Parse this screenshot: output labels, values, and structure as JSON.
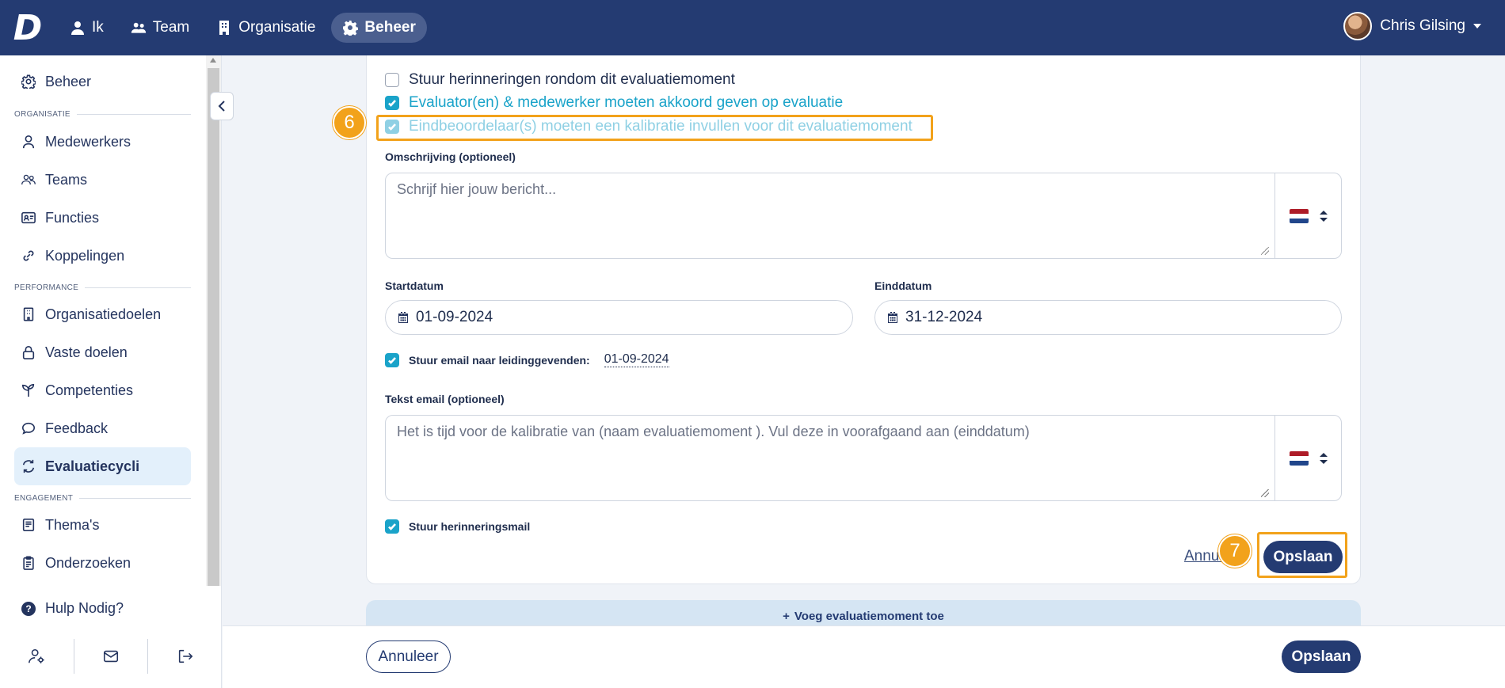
{
  "topbar": {
    "logo": "D",
    "nav": [
      {
        "label": "Ik",
        "icon": "person-icon"
      },
      {
        "label": "Team",
        "icon": "users-icon"
      },
      {
        "label": "Organisatie",
        "icon": "building-icon"
      },
      {
        "label": "Beheer",
        "icon": "gear-icon",
        "active": true
      }
    ],
    "user_name": "Chris Gilsing"
  },
  "sidebar": {
    "top_item": "Beheer",
    "sections": {
      "organisatie": "ORGANISATIE",
      "performance": "PERFORMANCE",
      "engagement": "ENGAGEMENT"
    },
    "items": {
      "medewerkers": "Medewerkers",
      "teams": "Teams",
      "functies": "Functies",
      "koppelingen": "Koppelingen",
      "organisatiedoelen": "Organisatiedoelen",
      "vaste_doelen": "Vaste doelen",
      "competenties": "Competenties",
      "feedback": "Feedback",
      "evaluatiecycli": "Evaluatiecycli",
      "themas": "Thema's",
      "onderzoeken": "Onderzoeken"
    },
    "help": "Hulp Nodig?"
  },
  "form": {
    "checkboxes": {
      "reminders": {
        "label": "Stuur herinneringen rondom dit evaluatiemoment",
        "checked": false
      },
      "agree": {
        "label": "Evaluator(en) & medewerker moeten akkoord geven op evaluatie",
        "checked": true
      },
      "calibration": {
        "label": "Eindbeoordelaar(s) moeten een kalibratie invullen voor dit evaluatiemoment",
        "checked": true
      }
    },
    "description_label": "Omschrijving (optioneel)",
    "description_placeholder": "Schrijf hier jouw bericht...",
    "start_label": "Startdatum",
    "start_value": "01-09-2024",
    "end_label": "Einddatum",
    "end_value": "31-12-2024",
    "email_managers_label": "Stuur email naar leidinggevenden:",
    "email_managers_date": "01-09-2024",
    "email_text_label": "Tekst email (optioneel)",
    "email_text_value": "Het is tijd voor de kalibratie van (naam evaluatiemoment ). Vul deze in voorafgaand aan (einddatum)",
    "reminder_mail_label": "Stuur herinneringsmail",
    "cancel_link": "Annuleer",
    "save_button": "Opslaan"
  },
  "add_moment": "Voeg evaluatiemoment toe",
  "footer": {
    "cancel": "Annuleer",
    "save": "Opslaan"
  },
  "annotations": {
    "step6": "6",
    "step7": "7"
  },
  "colors": {
    "topbar": "#243b72",
    "accent": "#1aa3c9",
    "highlight": "#f2a21b",
    "active_item_bg": "#e3f0fb"
  }
}
